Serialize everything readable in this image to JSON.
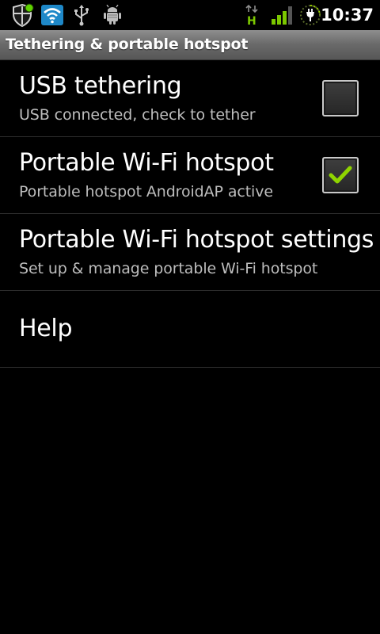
{
  "status_bar": {
    "time": "10:37",
    "left_icons": [
      "shield-icon",
      "wifi-icon",
      "usb-icon",
      "android-debug-icon"
    ],
    "right_icons": [
      "hspa-data-icon",
      "signal-strength-icon",
      "battery-charging-icon"
    ],
    "network_type": "H"
  },
  "title_bar": {
    "title": "Tethering & portable hotspot"
  },
  "settings": [
    {
      "title": "USB tethering",
      "summary": "USB connected, check to tether",
      "checked": false
    },
    {
      "title": "Portable Wi-Fi hotspot",
      "summary": "Portable hotspot AndroidAP active",
      "checked": true
    },
    {
      "title": "Portable Wi-Fi hotspot settings",
      "summary": "Set up & manage portable Wi-Fi hotspot"
    },
    {
      "title": "Help"
    }
  ],
  "colors": {
    "background": "#000000",
    "title_bar": "#6a6a6a",
    "summary_text": "#bdbdbd",
    "check_accent": "#8fd400",
    "wifi_accent": "#1e88c8",
    "notify_dot": "#5fd300"
  }
}
